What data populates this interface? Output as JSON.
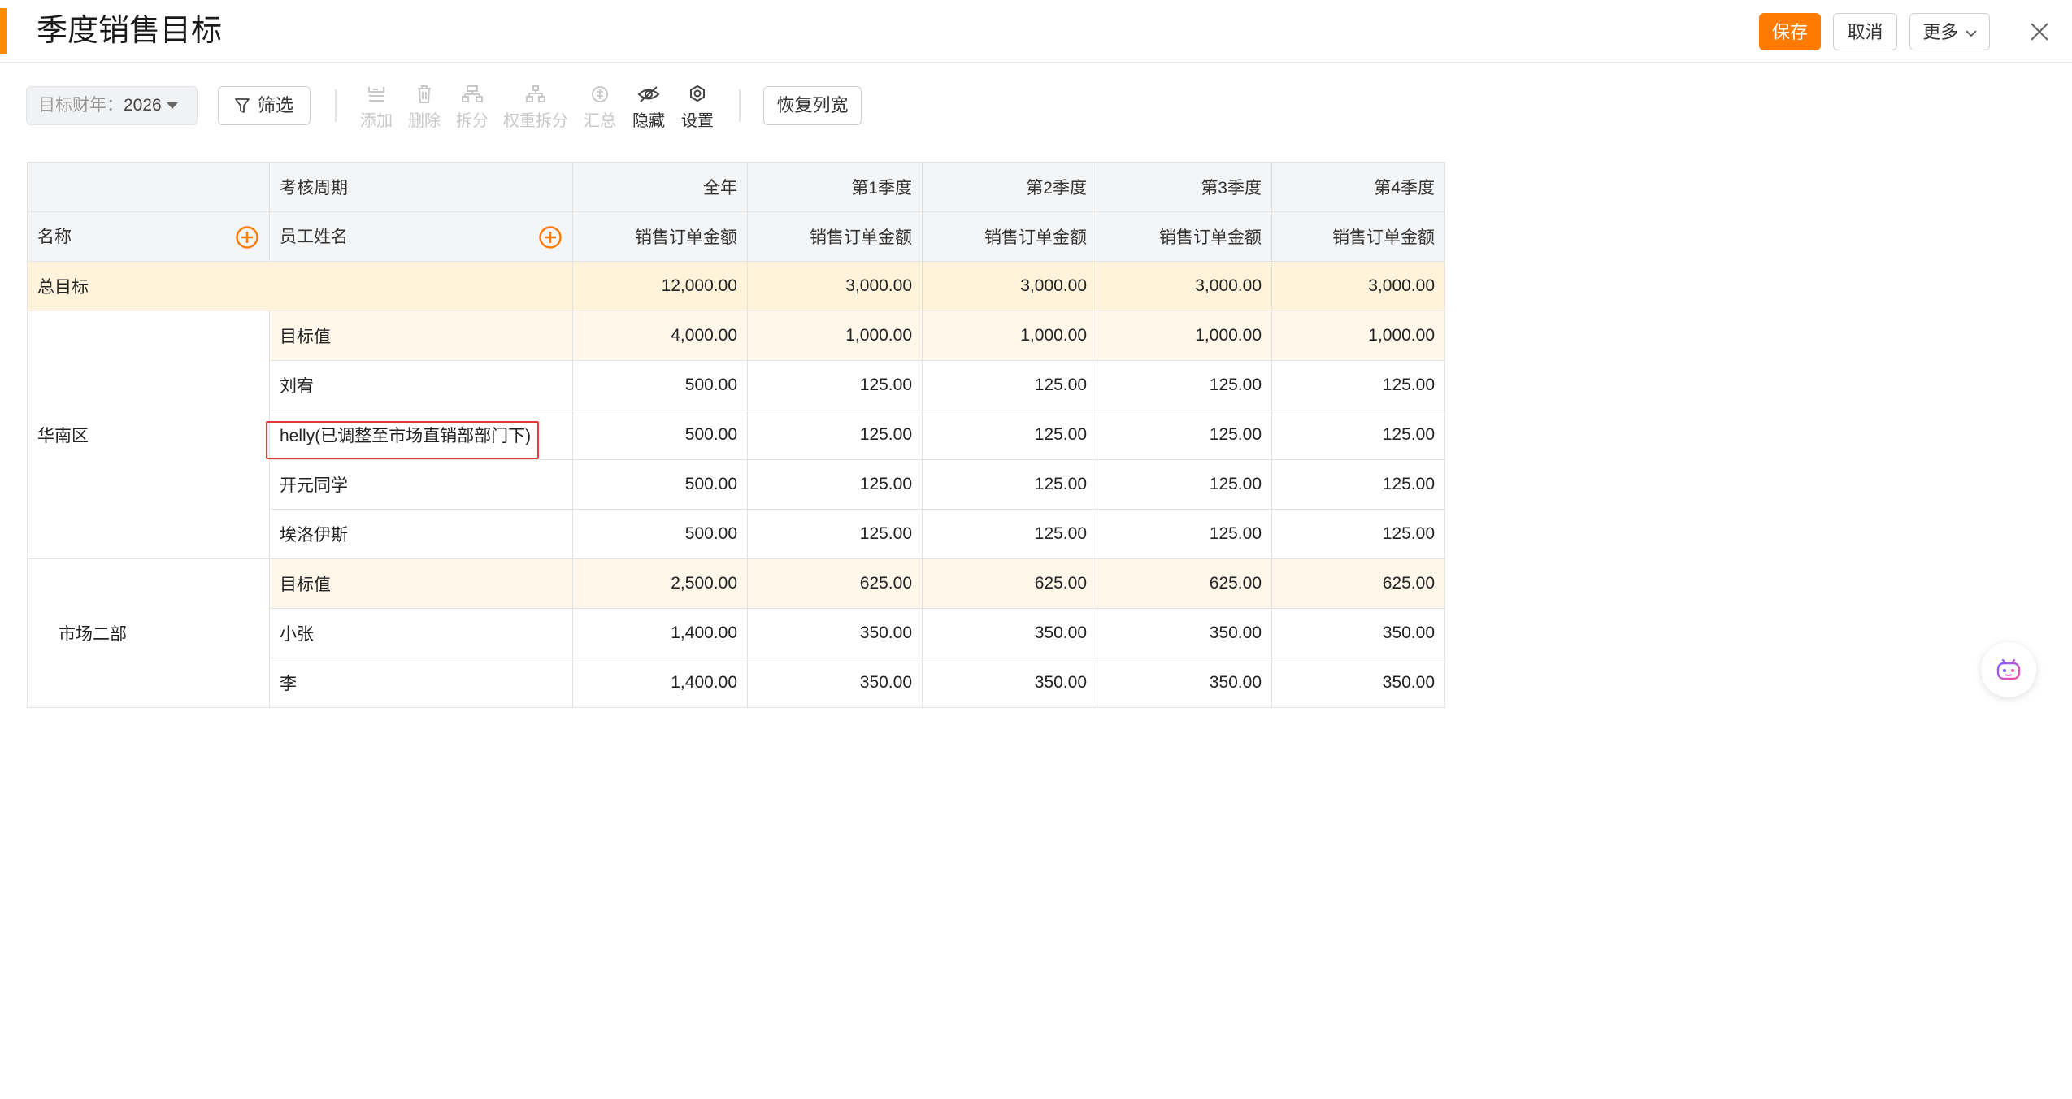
{
  "header": {
    "title": "季度销售目标",
    "save_label": "保存",
    "cancel_label": "取消",
    "more_label": "更多"
  },
  "toolbar": {
    "year_label": "目标财年：",
    "year_value": "2026",
    "filter_label": "筛选",
    "tools": [
      {
        "label": "添加",
        "enabled": false,
        "icon": "add-row-icon"
      },
      {
        "label": "删除",
        "enabled": false,
        "icon": "trash-icon"
      },
      {
        "label": "拆分",
        "enabled": false,
        "icon": "split-icon"
      },
      {
        "label": "权重拆分",
        "enabled": false,
        "icon": "weight-split-icon"
      },
      {
        "label": "汇总",
        "enabled": false,
        "icon": "sum-icon"
      },
      {
        "label": "隐藏",
        "enabled": true,
        "icon": "eye-off-icon"
      },
      {
        "label": "设置",
        "enabled": true,
        "icon": "gear-icon"
      }
    ],
    "restore_label": "恢复列宽"
  },
  "table": {
    "period_label": "考核周期",
    "name_col": "名称",
    "employee_col": "员工姓名",
    "periods": [
      "全年",
      "第1季度",
      "第2季度",
      "第3季度",
      "第4季度"
    ],
    "metric": "销售订单金额",
    "total": {
      "label": "总目标",
      "values": [
        "12,000.00",
        "3,000.00",
        "3,000.00",
        "3,000.00",
        "3,000.00"
      ]
    },
    "groups": [
      {
        "name": "华南区",
        "target": {
          "label": "目标值",
          "values": [
            "4,000.00",
            "1,000.00",
            "1,000.00",
            "1,000.00",
            "1,000.00"
          ]
        },
        "rows": [
          {
            "name": "刘宥",
            "values": [
              "500.00",
              "125.00",
              "125.00",
              "125.00",
              "125.00"
            ]
          },
          {
            "name": "helly(已调整至市场直销部部门下)",
            "values": [
              "500.00",
              "125.00",
              "125.00",
              "125.00",
              "125.00"
            ]
          },
          {
            "name": "开元同学",
            "values": [
              "500.00",
              "125.00",
              "125.00",
              "125.00",
              "125.00"
            ]
          },
          {
            "name": "埃洛伊斯",
            "values": [
              "500.00",
              "125.00",
              "125.00",
              "125.00",
              "125.00"
            ]
          }
        ]
      },
      {
        "name": "市场二部",
        "target": {
          "label": "目标值",
          "values": [
            "2,500.00",
            "625.00",
            "625.00",
            "625.00",
            "625.00"
          ]
        },
        "rows": [
          {
            "name": "小张",
            "values": [
              "1,400.00",
              "350.00",
              "350.00",
              "350.00",
              "350.00"
            ]
          },
          {
            "name": "李",
            "values": [
              "1,400.00",
              "350.00",
              "350.00",
              "350.00",
              "350.00"
            ]
          }
        ]
      }
    ]
  },
  "colors": {
    "accent": "#ff7a00",
    "total_row": "#fff3dc",
    "target_row": "#fff8ea",
    "highlight": "#e23b3b"
  }
}
